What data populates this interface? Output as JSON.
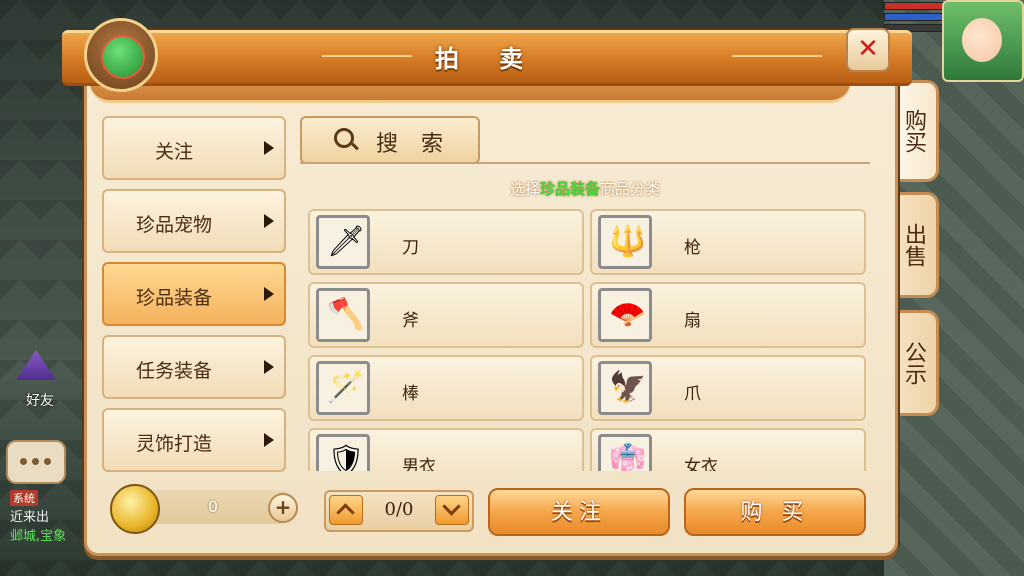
{
  "panel": {
    "title": "拍 卖"
  },
  "side_tabs": [
    {
      "label": "购买",
      "active": true
    },
    {
      "label": "出售",
      "active": false
    },
    {
      "label": "公示",
      "active": false
    }
  ],
  "categories": [
    {
      "label": "关注",
      "active": false
    },
    {
      "label": "珍品宠物",
      "active": false
    },
    {
      "label": "珍品装备",
      "active": true
    },
    {
      "label": "任务装备",
      "active": false
    },
    {
      "label": "灵饰打造",
      "active": false
    }
  ],
  "search": {
    "label": "搜 索"
  },
  "hint": {
    "prefix": "选择",
    "highlight": "珍品装备",
    "suffix": "商品分类"
  },
  "items": [
    {
      "name": "刀",
      "icon": "sword-icon",
      "glyph": "🗡"
    },
    {
      "name": "枪",
      "icon": "spear-icon",
      "glyph": "🔱"
    },
    {
      "name": "斧",
      "icon": "axe-icon",
      "glyph": "🪓"
    },
    {
      "name": "扇",
      "icon": "fan-icon",
      "glyph": "🪭"
    },
    {
      "name": "棒",
      "icon": "staff-icon",
      "glyph": "🪄"
    },
    {
      "name": "爪",
      "icon": "claw-icon",
      "glyph": "🦅"
    },
    {
      "name": "男衣",
      "icon": "male-armor-icon",
      "glyph": "🛡"
    },
    {
      "name": "女衣",
      "icon": "female-armor-icon",
      "glyph": "👘"
    }
  ],
  "currency": {
    "value": "0",
    "plus": "+"
  },
  "pager": {
    "text": "0/0"
  },
  "actions": {
    "follow": "关注",
    "buy": "购 买"
  },
  "hud": {
    "friend_label": "好友",
    "chat_tag": "系统",
    "chat_line1": "近来出",
    "chat_line2": "邺城,宝象"
  },
  "colors": {
    "highlight_green": "#42d33a",
    "title_orange": "#d47a24",
    "close_red": "#d11a1a"
  }
}
